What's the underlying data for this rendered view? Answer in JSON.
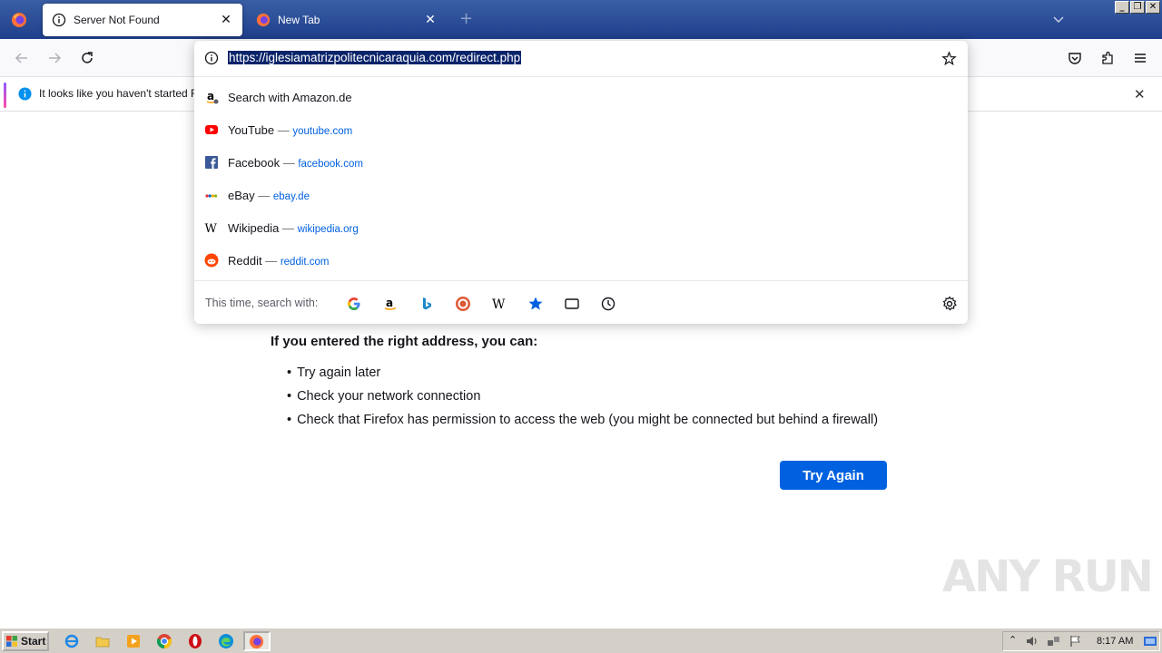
{
  "tabs": [
    {
      "title": "Server Not Found",
      "active": true
    },
    {
      "title": "New Tab",
      "active": false
    }
  ],
  "urlbar": {
    "url": "https://iglesiamatrizpolitecnicaraquia.com/redirect.php"
  },
  "notification": {
    "text": "It looks like you haven't started Fire"
  },
  "suggestions": [
    {
      "label": "Search with Amazon.de",
      "url": "",
      "icon": "amazon-icon"
    },
    {
      "label": "YouTube",
      "url": "youtube.com",
      "icon": "youtube-icon"
    },
    {
      "label": "Facebook",
      "url": "facebook.com",
      "icon": "facebook-icon"
    },
    {
      "label": "eBay",
      "url": "ebay.de",
      "icon": "ebay-icon"
    },
    {
      "label": "Wikipedia",
      "url": "wikipedia.org",
      "icon": "wikipedia-icon"
    },
    {
      "label": "Reddit",
      "url": "reddit.com",
      "icon": "reddit-icon"
    }
  ],
  "separator": "—",
  "oneoff": {
    "label": "This time, search with:",
    "engines": [
      "google-icon",
      "amazon-icon",
      "bing-icon",
      "duckduckgo-icon",
      "wikipedia-icon",
      "bookmarks-icon",
      "tabs-icon",
      "history-icon"
    ]
  },
  "content": {
    "heading": "If you entered the right address, you can:",
    "items": [
      "Try again later",
      "Check your network connection",
      "Check that Firefox has permission to access the web (you might be connected but behind a firewall)"
    ],
    "button": "Try Again"
  },
  "watermark": "ANY RUN",
  "taskbar": {
    "start": "Start",
    "clock": "8:17 AM"
  },
  "colors": {
    "accent": "#0061e0",
    "tabstrip": "#1f3f8c",
    "selection": "#0a246a"
  }
}
